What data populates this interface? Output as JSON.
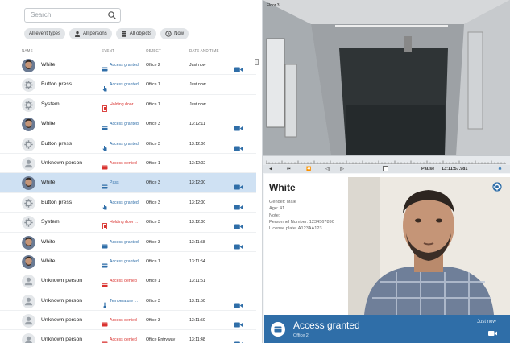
{
  "search": {
    "placeholder": "Search"
  },
  "filters": [
    {
      "label": "All event types",
      "icon": "none"
    },
    {
      "label": "All persons",
      "icon": "person-icon"
    },
    {
      "label": "All objects",
      "icon": "building-icon"
    },
    {
      "label": "Now",
      "icon": "clock-icon"
    }
  ],
  "columns": {
    "name": "NAME",
    "event": "EVENT",
    "object": "OBJECT",
    "datetime": "DATE AND TIME"
  },
  "rows": [
    {
      "avatar": "face",
      "name": "White",
      "event": "Access granted",
      "event_type": "access-card",
      "event_color": "#2f6ea8",
      "object": "Office 2",
      "time": "Just now",
      "camera": true
    },
    {
      "avatar": "gear",
      "name": "Button press",
      "event": "Access granted",
      "event_type": "button",
      "event_color": "#2f6ea8",
      "object": "Office 1",
      "time": "Just now",
      "camera": false
    },
    {
      "avatar": "gear",
      "name": "System",
      "event": "Holding door ...",
      "event_type": "door",
      "event_color": "#d9322f",
      "object": "Office 1",
      "time": "Just now",
      "camera": false
    },
    {
      "avatar": "face",
      "name": "White",
      "event": "Access granted",
      "event_type": "access-card",
      "event_color": "#2f6ea8",
      "object": "Office 3",
      "time": "13:12:11",
      "camera": true
    },
    {
      "avatar": "gear",
      "name": "Button press",
      "event": "Access granted",
      "event_type": "button",
      "event_color": "#2f6ea8",
      "object": "Office 3",
      "time": "13:12:06",
      "camera": true
    },
    {
      "avatar": "person",
      "name": "Unknown person",
      "event": "Access denied",
      "event_type": "access-card",
      "event_color": "#d9322f",
      "object": "Office 1",
      "time": "13:12:02",
      "camera": false
    },
    {
      "avatar": "face",
      "name": "White",
      "event": "Pass",
      "event_type": "access-card",
      "event_color": "#2f6ea8",
      "object": "Office 3",
      "time": "13:12:00",
      "camera": true,
      "selected": true
    },
    {
      "avatar": "gear",
      "name": "Button press",
      "event": "Access granted",
      "event_type": "button",
      "event_color": "#2f6ea8",
      "object": "Office 3",
      "time": "13:12:00",
      "camera": true
    },
    {
      "avatar": "gear",
      "name": "System",
      "event": "Holding door ...",
      "event_type": "door",
      "event_color": "#d9322f",
      "object": "Office 3",
      "time": "13:12:00",
      "camera": true
    },
    {
      "avatar": "face",
      "name": "White",
      "event": "Access granted",
      "event_type": "access-card",
      "event_color": "#2f6ea8",
      "object": "Office 3",
      "time": "13:11:58",
      "camera": true
    },
    {
      "avatar": "face",
      "name": "White",
      "event": "Access granted",
      "event_type": "access-card",
      "event_color": "#2f6ea8",
      "object": "Office 1",
      "time": "13:11:54",
      "camera": false
    },
    {
      "avatar": "person",
      "name": "Unknown person",
      "event": "Access denied",
      "event_type": "access-card",
      "event_color": "#d9322f",
      "object": "Office 1",
      "time": "13:11:51",
      "camera": false
    },
    {
      "avatar": "person",
      "name": "Unknown person",
      "event": "Temperature ...",
      "event_type": "thermometer",
      "event_color": "#2f6ea8",
      "object": "Office 3",
      "time": "13:11:50",
      "camera": true
    },
    {
      "avatar": "person",
      "name": "Unknown person",
      "event": "Access denied",
      "event_type": "access-card",
      "event_color": "#d9322f",
      "object": "Office 3",
      "time": "13:11:50",
      "camera": true
    },
    {
      "avatar": "person",
      "name": "Unknown person",
      "event": "Access denied",
      "event_type": "access-card",
      "event_color": "#d9322f",
      "object": "Office Entryway",
      "time": "13:11:48",
      "camera": true
    }
  ],
  "video": {
    "label": "Floor 3"
  },
  "player": {
    "state": "Pause",
    "clock": "13:11:57.981"
  },
  "detail": {
    "name": "White",
    "gender": "Gender: Male",
    "age": "Age: 41",
    "note": "Note:",
    "personnel": "Personnel Number: 1234567890",
    "plate": "License plate: A123AA123"
  },
  "banner": {
    "title": "Access granted",
    "object": "Office 2",
    "when": "Just now",
    "color": "#2f6ea8"
  }
}
